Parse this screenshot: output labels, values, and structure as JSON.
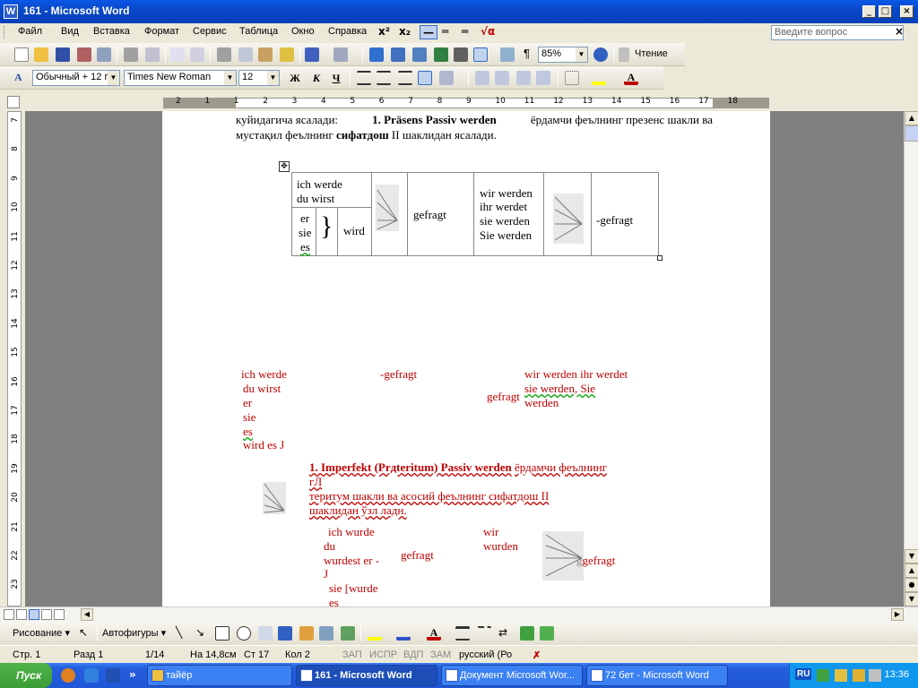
{
  "window": {
    "title": "161 - Microsoft Word",
    "app_icon_letter": "W",
    "min": "_",
    "max": "□",
    "close": "×"
  },
  "menu": {
    "items": [
      "Файл",
      "Вид",
      "Вставка",
      "Формат",
      "Сервис",
      "Таблица",
      "Окно",
      "Справка"
    ],
    "help_placeholder": "Введите вопрос",
    "doc_close": "×",
    "sqrt_label": "√α"
  },
  "standard_toolbar": {
    "zoom": "85%",
    "reading_label": "Чтение"
  },
  "formatting_toolbar": {
    "style": "Обычный + 12 г",
    "font": "Times New Roman",
    "size": "12",
    "bold": "Ж",
    "italic": "К",
    "underline": "Ч"
  },
  "ruler": {
    "h_ticks": [
      "2",
      "1",
      "1",
      "2",
      "3",
      "4",
      "5",
      "6",
      "7",
      "8",
      "9",
      "10",
      "11",
      "12",
      "13",
      "14",
      "15",
      "16",
      "17",
      "18"
    ],
    "v_ticks": [
      "7",
      "8",
      "9",
      "10",
      "11",
      "12",
      "13",
      "14",
      "15",
      "16",
      "17",
      "18",
      "19",
      "20",
      "21",
      "22",
      "23"
    ]
  },
  "document": {
    "line1_a": "куйидагича ясалади:",
    "line1_b": "1. Präsens Passiv werden",
    "line1_c": "ёрдамчи феълнинг презенс шакли ва",
    "line2_a": "мустақил феълнинг",
    "line2_b": "сифатдош",
    "line2_c": "II шаклидан ясалади.",
    "table": {
      "c1a": "ich werde",
      "c1b": "du wirst",
      "er": "er",
      "sie": "sie",
      "es": "es",
      "wird": "wird",
      "gefragt1": "gefragt",
      "plural1": "wir werden",
      "plural2": "ihr werdet",
      "plural3": "sie werden",
      "plural4": "Sie werden",
      "gefragt2": "-gefragt"
    },
    "red_block1": {
      "l1": "ich werde",
      "l2": "du wirst",
      "l3": "er",
      "l4": "sie",
      "l5": "es",
      "l6": "wird es   J",
      "gefragt_a": "-gefragt",
      "gefragt_b": "gefragt",
      "pl_1": "wir werden ihr werdet",
      "pl_2": "sie  werden, Sie",
      "pl_3": "werden"
    },
    "red_block2": {
      "h1_a": "1. Imperfekt (Prдteritum) Passiv werden",
      "h1_b": "ёрдамчи феълнинг",
      "h2": "гЛ",
      "h3": "теритум шакли ва асосий феълнинг сифатдош II",
      "h4": "шаклидан ўзл ладн."
    },
    "red_block3": {
      "l1": "ich wurde",
      "l2": "du",
      "l3": "wurdest er -",
      "l4": "J",
      "l5": "sie [wurde",
      "l6": "es",
      "gefragt_a": "gefragt",
      "wir": "wir",
      "wurden": "wurden",
      "gefragt_b": "gefragt",
      "g_prefix": "g"
    }
  },
  "drawbar": {
    "draw_label": "Рисование",
    "autoshapes_label": "Автофигуры"
  },
  "status": {
    "page": "Стр. 1",
    "section": "Разд 1",
    "pages": "1/14",
    "at": "На 14,8см",
    "line": "Ст 17",
    "col": "Кол 2",
    "rec": "ЗАП",
    "trk": "ИСПР",
    "ext": "ВДП",
    "ovr": "ЗАМ",
    "lang": "русский (Ро"
  },
  "taskbar": {
    "start": "Пуск",
    "more": "»",
    "tasks": [
      "тайёр",
      "161 - Microsoft Word",
      "Документ Microsoft Wor...",
      "72 бет - Microsoft Word"
    ],
    "lang": "RU",
    "clock": "13:36"
  },
  "colors": {
    "accent_red": "#C00000",
    "titlebar": "#0A48C8",
    "taskbar": "#245EDC"
  }
}
